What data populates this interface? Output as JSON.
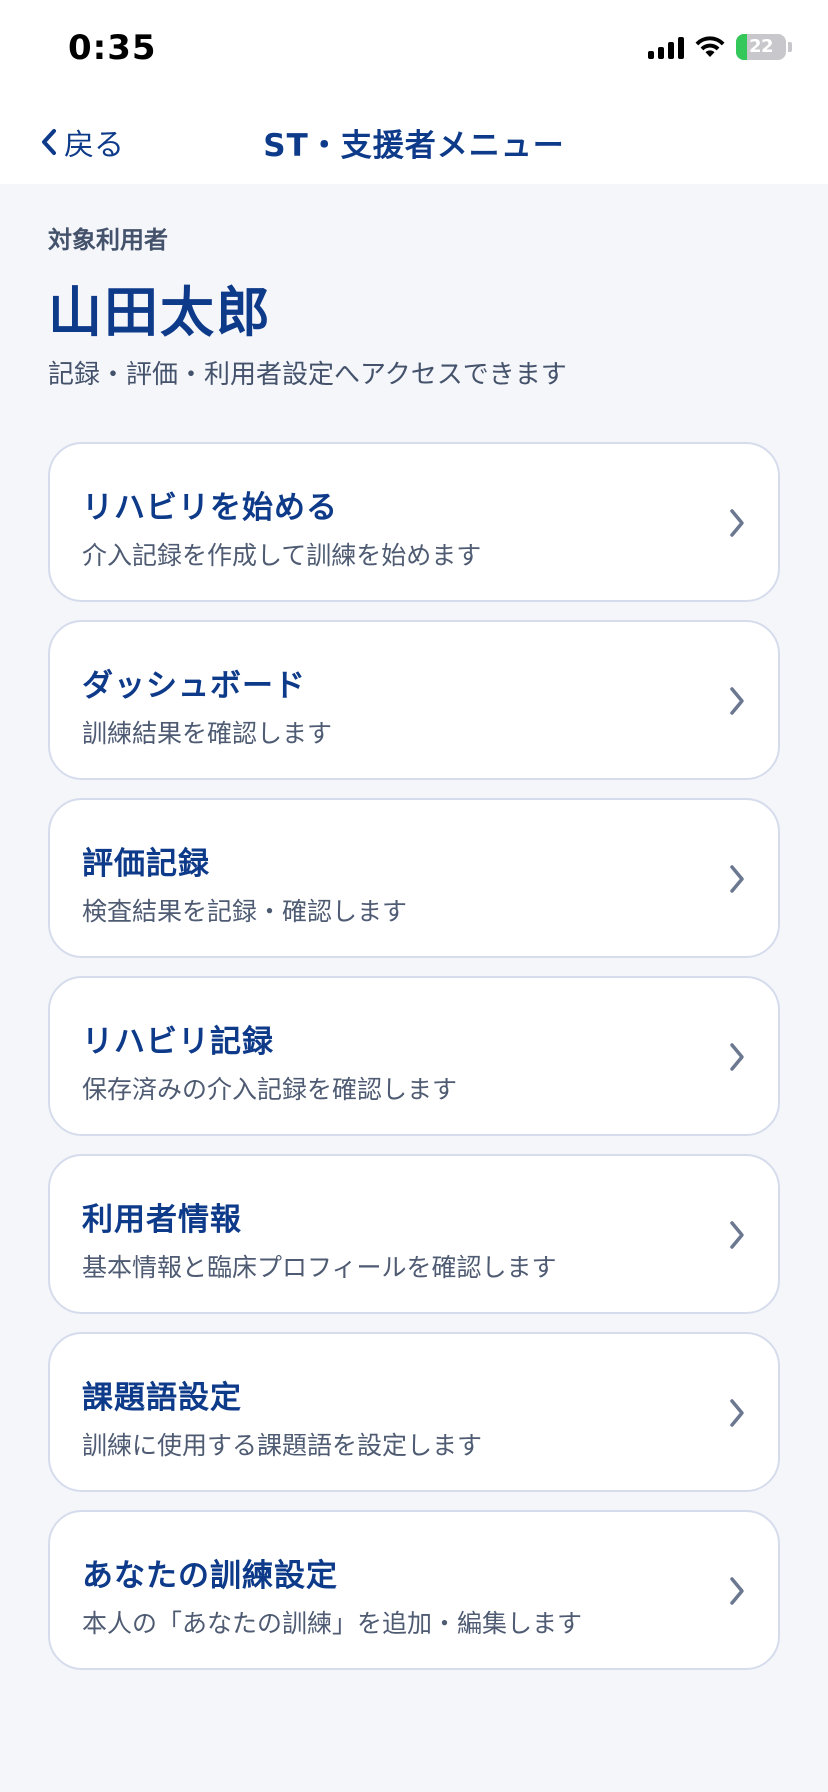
{
  "status_bar": {
    "time": "0:35",
    "battery_level": "22",
    "battery_fraction": 0.22
  },
  "nav": {
    "back_label": "戻る",
    "title": "ST・支援者メニュー"
  },
  "header": {
    "target_label": "対象利用者",
    "user_name": "山田太郎",
    "description": "記録・評価・利用者設定へアクセスできます"
  },
  "menu": {
    "items": [
      {
        "title": "リハビリを始める",
        "subtitle": "介入記録を作成して訓練を始めます"
      },
      {
        "title": "ダッシュボード",
        "subtitle": "訓練結果を確認します"
      },
      {
        "title": "評価記録",
        "subtitle": "検査結果を記録・確認します"
      },
      {
        "title": "リハビリ記録",
        "subtitle": "保存済みの介入記録を確認します"
      },
      {
        "title": "利用者情報",
        "subtitle": "基本情報と臨床プロフィールを確認します"
      },
      {
        "title": "課題語設定",
        "subtitle": "訓練に使用する課題語を設定します"
      },
      {
        "title": "あなたの訓練設定",
        "subtitle": "本人の「あなたの訓練」を追加・編集します"
      }
    ]
  },
  "colors": {
    "accent": "#0e3a8a",
    "background": "#f4f6fa",
    "card_border": "#d6dcec",
    "battery_green": "#34c759"
  },
  "icons": {
    "back": "chevron-left-icon",
    "row": "chevron-right-icon",
    "signal": "cellular-signal-icon",
    "wifi": "wifi-icon",
    "battery": "battery-icon"
  }
}
